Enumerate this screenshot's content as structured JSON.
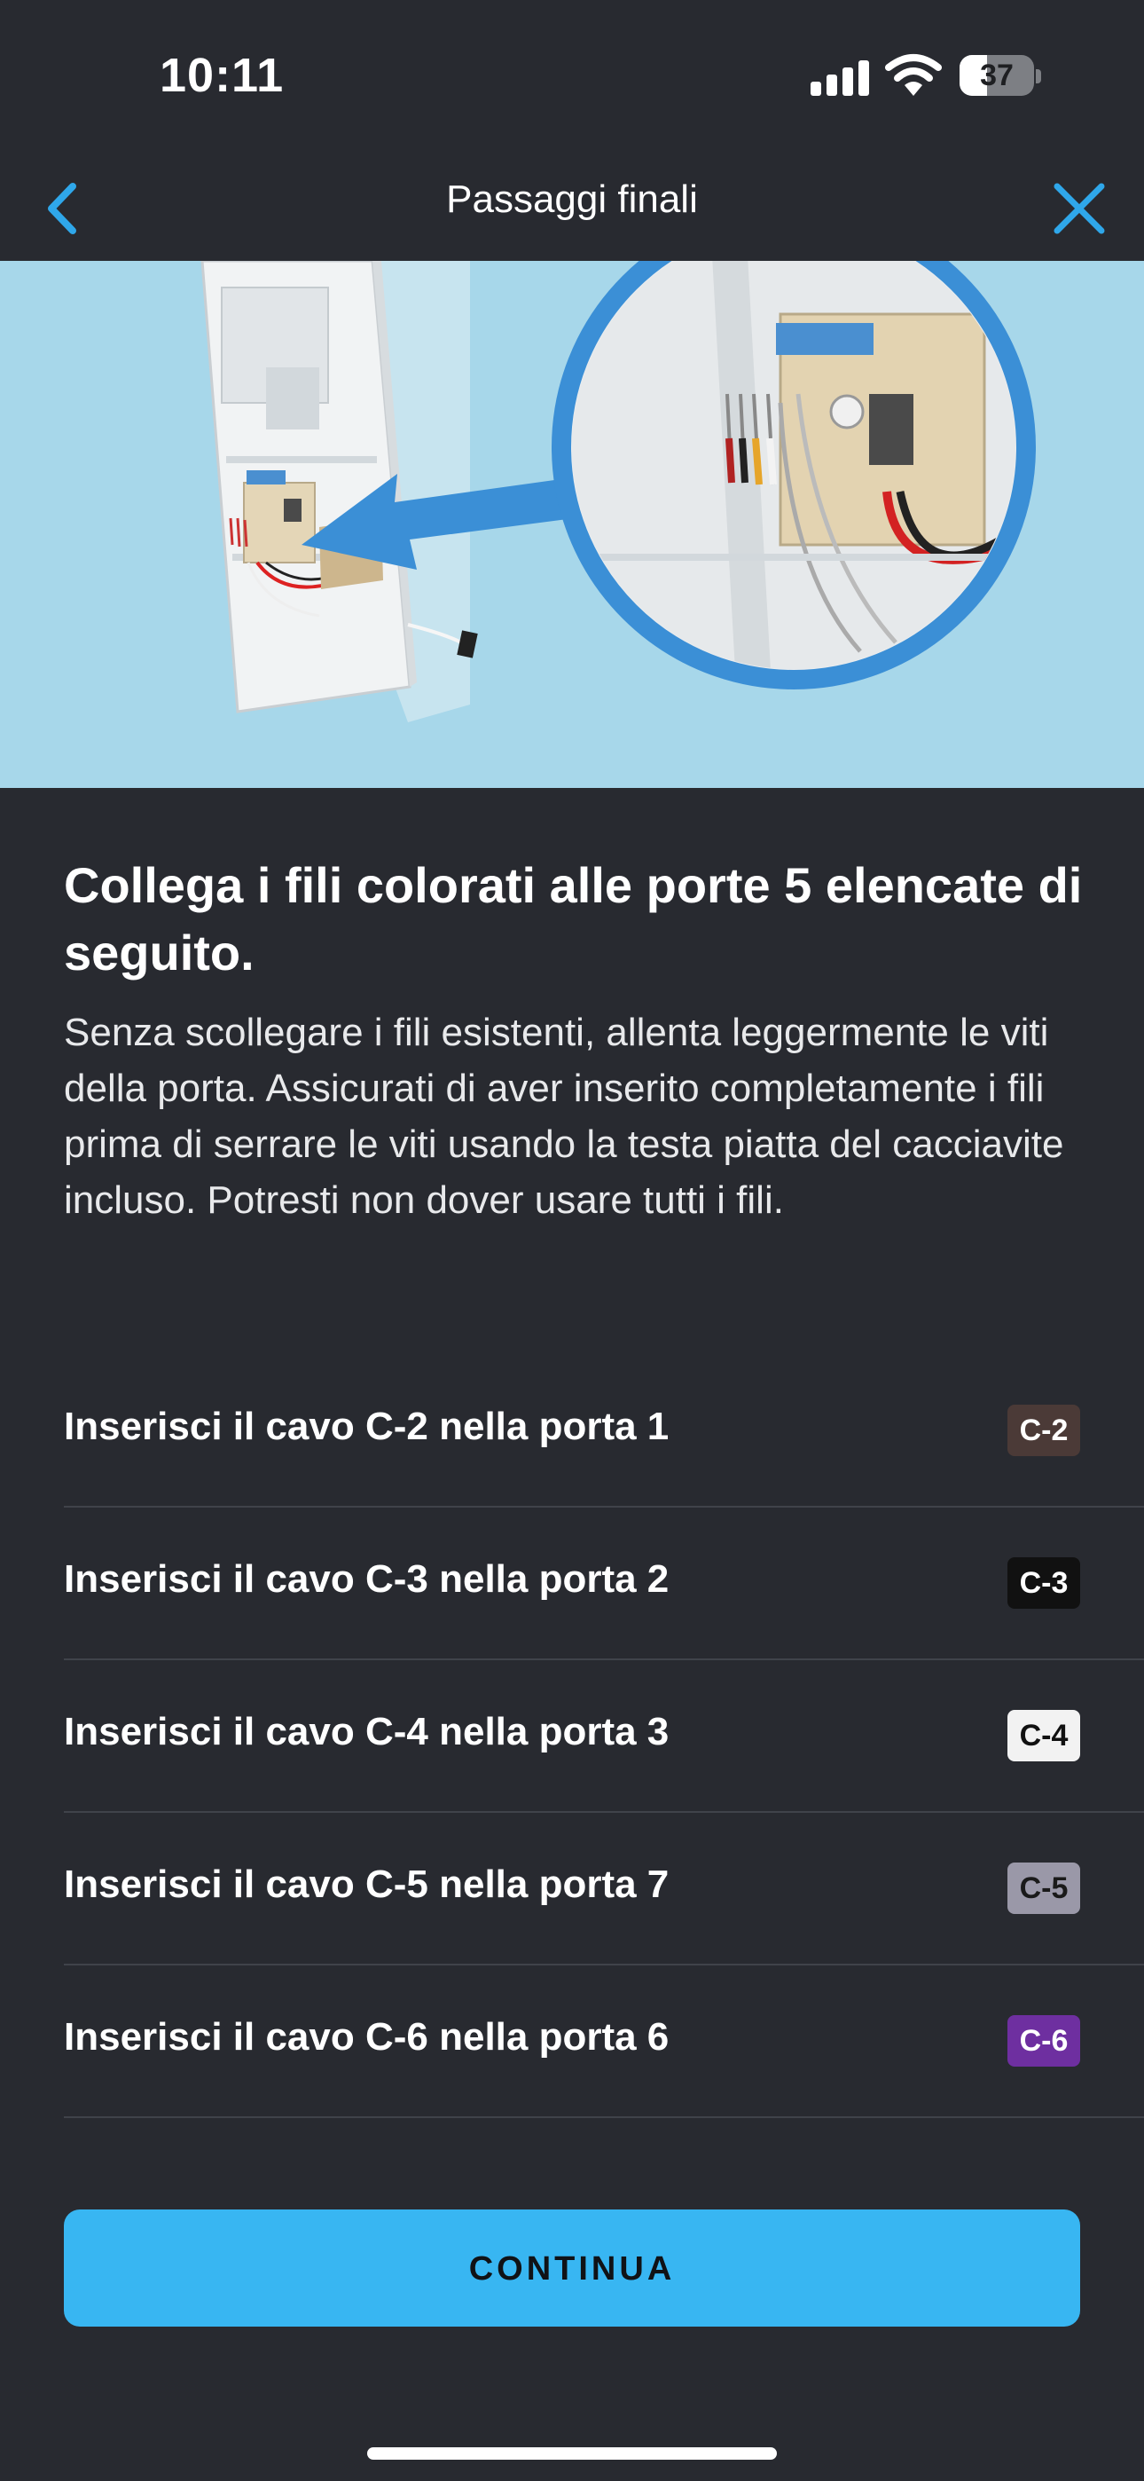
{
  "status": {
    "time": "10:11",
    "battery": "37",
    "battery_level": 0.37
  },
  "nav": {
    "title": "Passaggi finali",
    "back_icon": "chevron-left-icon",
    "close_icon": "close-icon",
    "accent": "#2fa7ea"
  },
  "content": {
    "heading": "Collega i fili colorati alle porte 5 elencate di seguito.",
    "description": "Senza scollegare i fili esistenti, allenta leggermente le viti della porta. Assicurati di aver inserito completamente i fili prima di serrare le viti usando la testa piatta del cacciavite incluso. Potresti non dover usare tutti i fili."
  },
  "wires": [
    {
      "label": "Inserisci il cavo C-2 nella porta 1",
      "badge": "C-2",
      "color": "#4b3a37",
      "text_color": "#ffffff"
    },
    {
      "label": "Inserisci il cavo C-3 nella porta 2",
      "badge": "C-3",
      "color": "#111111",
      "text_color": "#ffffff"
    },
    {
      "label": "Inserisci il cavo C-4 nella porta 3",
      "badge": "C-4",
      "color": "#f2f2f2",
      "text_color": "#111111"
    },
    {
      "label": "Inserisci il cavo C-5 nella porta 7",
      "badge": "C-5",
      "color": "#9a98a8",
      "text_color": "#1a1a1a"
    },
    {
      "label": "Inserisci il cavo C-6 nella porta 6",
      "badge": "C-6",
      "color": "#6e2fa0",
      "text_color": "#ffffff"
    }
  ],
  "actions": {
    "continue_label": "CONTINUA",
    "continue_color": "#38b6f2"
  }
}
